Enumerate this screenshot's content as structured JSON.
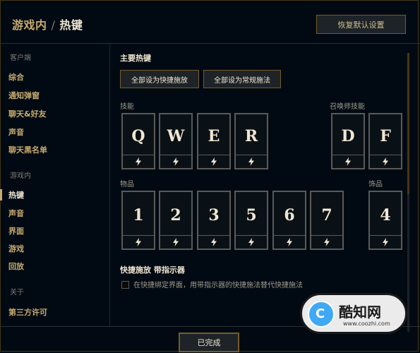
{
  "header": {
    "section": "游戏内",
    "separator": "/",
    "page": "热键",
    "restore_label": "恢复默认设置"
  },
  "sidebar": {
    "client_label": "客户端",
    "client_items": [
      "综合",
      "通知弹窗",
      "聊天&好友",
      "声音",
      "聊天黑名单"
    ],
    "ingame_label": "游戏内",
    "ingame_items": [
      "热键",
      "声音",
      "界面",
      "游戏",
      "回放"
    ],
    "about_label": "关于",
    "about_items": [
      "第三方许可"
    ]
  },
  "main": {
    "primary_title": "主要热键",
    "btn_all_quick": "全部设为快捷施放",
    "btn_all_normal": "全部设为常规施法",
    "abilities_label": "技能",
    "summoner_label": "召唤师技能",
    "items_label": "物品",
    "trinket_label": "饰品",
    "abilities": [
      "Q",
      "W",
      "E",
      "R"
    ],
    "summoner": [
      "D",
      "F"
    ],
    "items": [
      "1",
      "2",
      "3",
      "5",
      "6",
      "7"
    ],
    "trinket": [
      "4"
    ],
    "quickcast_title": "快捷施放 带指示器",
    "quickcast_option": "在快捷绑定界面，用带指示器的快捷施法替代快捷施法",
    "quickcast_checked": false
  },
  "footer": {
    "done_label": "已完成"
  },
  "watermark": {
    "name": "酷知网",
    "url": "www.coozhi.com",
    "logo_letter": "C"
  },
  "colors": {
    "gold": "#c8aa6e",
    "border_gold": "#785a28",
    "background": "#010a13"
  }
}
